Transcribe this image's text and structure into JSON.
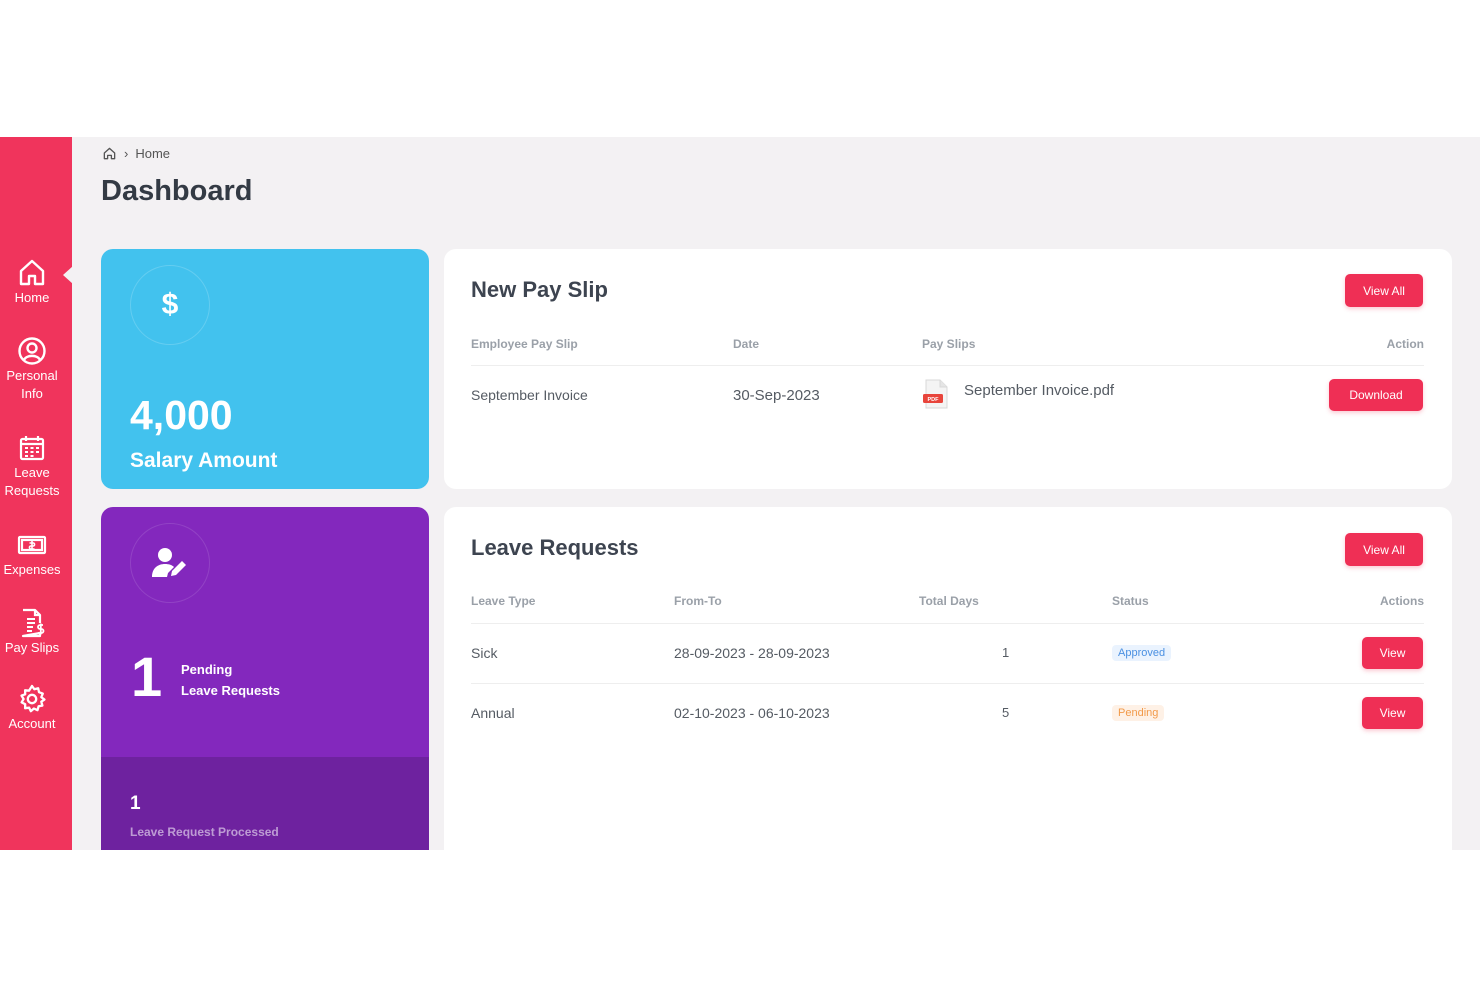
{
  "sidebar": {
    "items": [
      {
        "label": "Home",
        "icon": "home-icon"
      },
      {
        "label": "Personal\nInfo",
        "icon": "user-circle-icon"
      },
      {
        "label": "Leave\nRequests",
        "icon": "calendar-icon"
      },
      {
        "label": "Expenses",
        "icon": "money-icon"
      },
      {
        "label": "Pay Slips",
        "icon": "payslip-icon"
      },
      {
        "label": "Account",
        "icon": "gear-icon"
      }
    ]
  },
  "header": {
    "breadcrumb": "Home",
    "title": "Dashboard"
  },
  "salary_card": {
    "icon": "dollar-icon",
    "value": "4,000",
    "label": "Salary Amount"
  },
  "leave_card": {
    "icon": "user-edit-icon",
    "pending_count": "1",
    "pending_label_line1": "Pending",
    "pending_label_line2": "Leave Requests",
    "processed_count": "1",
    "processed_label": "Leave Request Processed"
  },
  "pay_slip_panel": {
    "title": "New Pay Slip",
    "view_all_label": "View All",
    "columns": [
      "Employee Pay Slip",
      "Date",
      "Pay Slips",
      "Action"
    ],
    "rows": [
      {
        "name": "September Invoice",
        "date": "30-Sep-2023",
        "file": "September Invoice.pdf",
        "action": "Download"
      }
    ]
  },
  "leave_panel": {
    "title": "Leave Requests",
    "view_all_label": "View All",
    "columns": [
      "Leave Type",
      "From-To",
      "Total Days",
      "Status",
      "Actions"
    ],
    "rows": [
      {
        "type": "Sick",
        "range": "28-09-2023 - 28-09-2023",
        "days": "1",
        "status": "Approved",
        "action": "View"
      },
      {
        "type": "Annual",
        "range": "02-10-2023 - 06-10-2023",
        "days": "5",
        "status": "Pending",
        "action": "View"
      }
    ]
  },
  "colors": {
    "sidebar": "#f0345c",
    "accent": "#ef2f55",
    "salary_card": "#42c2ee",
    "leave_card": "#8328bd",
    "approved": "#4a90e2",
    "pending": "#f29a4a"
  }
}
